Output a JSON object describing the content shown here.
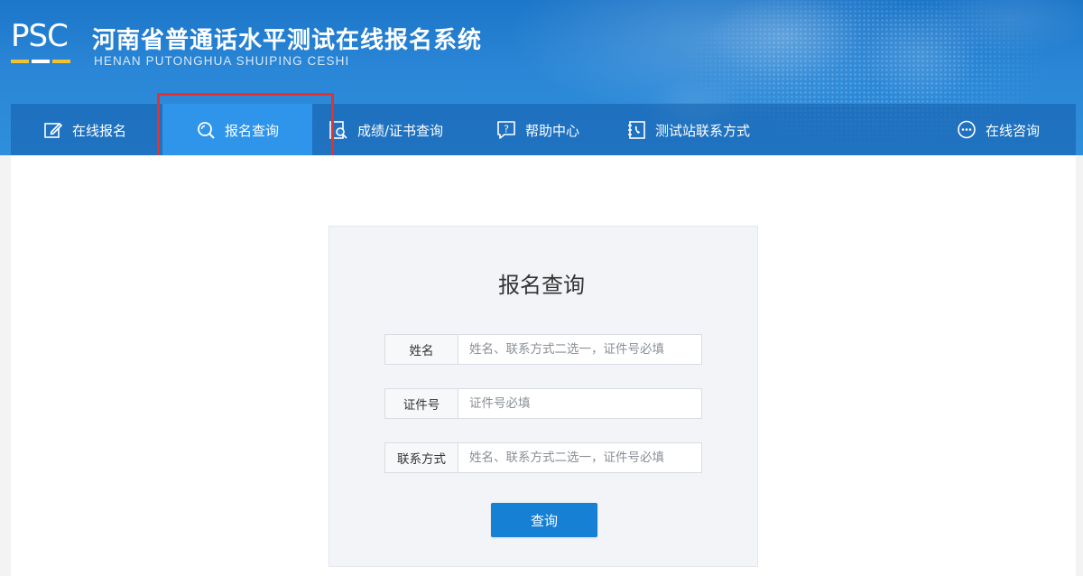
{
  "header": {
    "logo_text": "PSC",
    "logo_colors": [
      "#f2c230",
      "#ffffff",
      "#f2c230"
    ],
    "title": "河南省普通话水平测试在线报名系统",
    "subtitle": "HENAN PUTONGHUA SHUIPING CESHI"
  },
  "nav": {
    "items": [
      {
        "label": "在线报名",
        "icon": "edit-icon"
      },
      {
        "label": "报名查询",
        "icon": "search-icon",
        "active": true
      },
      {
        "label": "成绩/证书查询",
        "icon": "certificate-search-icon"
      },
      {
        "label": "帮助中心",
        "icon": "help-icon"
      },
      {
        "label": "测试站联系方式",
        "icon": "contact-phone-icon"
      }
    ],
    "online_consult": {
      "label": "在线咨询",
      "icon": "chat-bubble-icon"
    }
  },
  "annotation": {
    "highlight_color": "#e4322f"
  },
  "form": {
    "title": "报名查询",
    "fields": [
      {
        "label": "姓名",
        "placeholder": "姓名、联系方式二选一，证件号必填"
      },
      {
        "label": "证件号",
        "placeholder": "证件号必填"
      },
      {
        "label": "联系方式",
        "placeholder": "姓名、联系方式二选一，证件号必填"
      }
    ],
    "submit_label": "查询"
  },
  "colors": {
    "header_blue": "#1d76c9",
    "nav_active": "#2f95ea",
    "button_blue": "#1680d4"
  }
}
